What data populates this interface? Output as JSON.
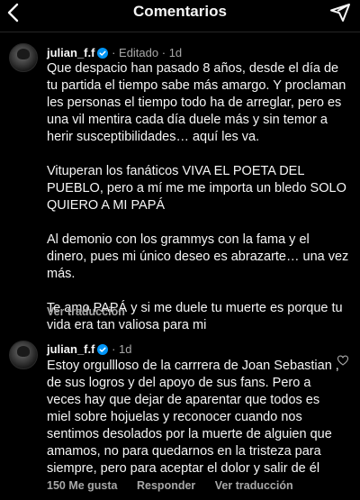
{
  "header": {
    "title": "Comentarios"
  },
  "comments": [
    {
      "username": "julian_f.f",
      "edited": "· Editado",
      "time": "· 1d",
      "paragraphs": [
        "Que despacio han pasado 8 años, desde el día de tu partida el tiempo sabe más amargo. Y proclaman les personas el tiempo todo ha de arreglar, pero es una vil mentira cada día duele más y sin temor a herir susceptibilidades… aquí les va.",
        "Vituperan los fanáticos VIVA EL POETA DEL PUEBLO, pero a mí me me importa un bledo SOLO QUIERO A MI PAPÁ",
        "Al demonio con los grammys con la fama y el dinero, pues mi único deseo es abrazarte… una vez más.",
        "Te amo PAPÁ y si me duele tu muerte es porque tu vida era tan valiosa para mi"
      ],
      "translate_label": "Ver traducción"
    },
    {
      "username": "julian_f.f",
      "time": "· 1d",
      "text": "Estoy orgullloso de la carrrera de Joan Sebastian , de sus logros y del apoyo de sus fans. Pero a veces hay que dejar de aparentar que todos es miel sobre hojuelas y reconocer cuando nos sentimos desolados por la muerte de alguien que amamos, no para quedarnos en la tristeza para siempre, pero para aceptar el dolor y salir de él",
      "likes_label": "150 Me gusta",
      "reply_label": "Responder",
      "translate_label": "Ver traducción"
    }
  ],
  "icons": {
    "back": "chevron-left-icon",
    "send": "paper-plane-icon",
    "verified": "verified-badge-icon",
    "like": "heart-outline-icon"
  },
  "colors": {
    "background": "#000000",
    "text": "#f5f5f5",
    "muted": "#a8a8a8",
    "verified": "#0095f6"
  }
}
